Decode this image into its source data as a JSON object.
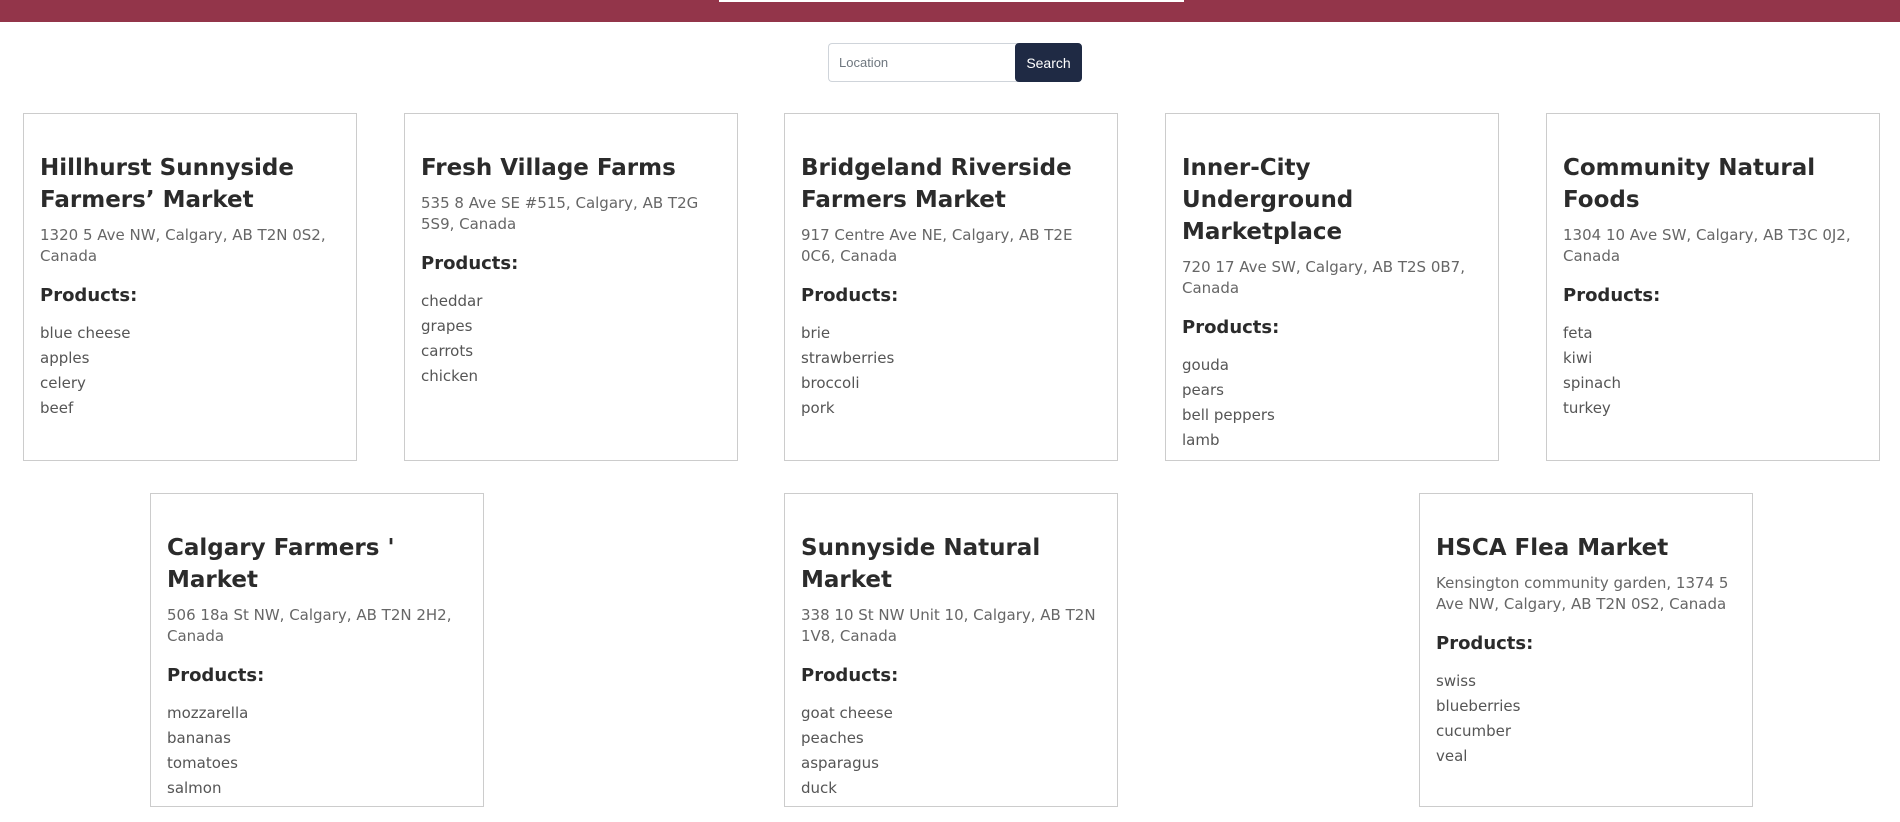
{
  "search": {
    "placeholder": "Location",
    "button_label": "Search"
  },
  "markets": [
    {
      "name": "Hillhurst Sunnyside Farmers’ Market",
      "address": "1320 5 Ave NW, Calgary, AB T2N 0S2, Canada",
      "products_label": "Products:",
      "products": [
        "blue cheese",
        "apples",
        "celery",
        "beef"
      ]
    },
    {
      "name": "Fresh Village Farms",
      "address": "535 8 Ave SE #515, Calgary, AB T2G 5S9, Canada",
      "products_label": "Products:",
      "products": [
        "cheddar",
        "grapes",
        "carrots",
        "chicken"
      ]
    },
    {
      "name": "Bridgeland Riverside Farmers Market",
      "address": "917 Centre Ave NE, Calgary, AB T2E 0C6, Canada",
      "products_label": "Products:",
      "products": [
        "brie",
        "strawberries",
        "broccoli",
        "pork"
      ]
    },
    {
      "name": "Inner-City Underground Marketplace",
      "address": "720 17 Ave SW, Calgary, AB T2S 0B7, Canada",
      "products_label": "Products:",
      "products": [
        "gouda",
        "pears",
        "bell peppers",
        "lamb"
      ]
    },
    {
      "name": "Community Natural Foods",
      "address": "1304 10 Ave SW, Calgary, AB T3C 0J2, Canada",
      "products_label": "Products:",
      "products": [
        "feta",
        "kiwi",
        "spinach",
        "turkey"
      ]
    },
    {
      "name": "Calgary Farmers ' Market",
      "address": "506 18a St NW, Calgary, AB T2N 2H2, Canada",
      "products_label": "Products:",
      "products": [
        "mozzarella",
        "bananas",
        "tomatoes",
        "salmon"
      ]
    },
    {
      "name": "Sunnyside Natural Market",
      "address": "338 10 St NW Unit 10, Calgary, AB T2N 1V8, Canada",
      "products_label": "Products:",
      "products": [
        "goat cheese",
        "peaches",
        "asparagus",
        "duck"
      ]
    },
    {
      "name": "HSCA Flea Market",
      "address": "Kensington community garden, 1374 5 Ave NW, Calgary, AB T2N 0S2, Canada",
      "products_label": "Products:",
      "products": [
        "swiss",
        "blueberries",
        "cucumber",
        "veal"
      ]
    }
  ],
  "colors": {
    "header_bar": "#93354a",
    "search_button": "#1f2a44"
  }
}
